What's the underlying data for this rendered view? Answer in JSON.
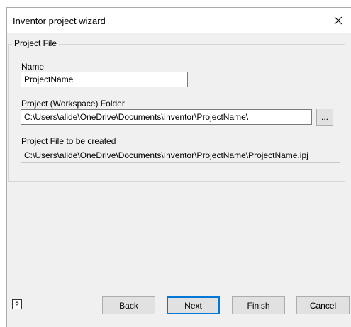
{
  "dialog": {
    "title": "Inventor project wizard",
    "close_icon": "close-icon"
  },
  "project_file": {
    "group_label": "Project File",
    "name_label": "Name",
    "name_value": "ProjectName",
    "folder_label": "Project (Workspace) Folder",
    "folder_value": "C:\\Users\\alide\\OneDrive\\Documents\\Inventor\\ProjectName\\",
    "browse_label": "...",
    "file_label": "Project File to be created",
    "file_value": "C:\\Users\\alide\\OneDrive\\Documents\\Inventor\\ProjectName\\ProjectName.ipj"
  },
  "buttons": {
    "help_icon": "help-icon",
    "back": "Back",
    "next": "Next",
    "finish": "Finish",
    "cancel": "Cancel"
  }
}
